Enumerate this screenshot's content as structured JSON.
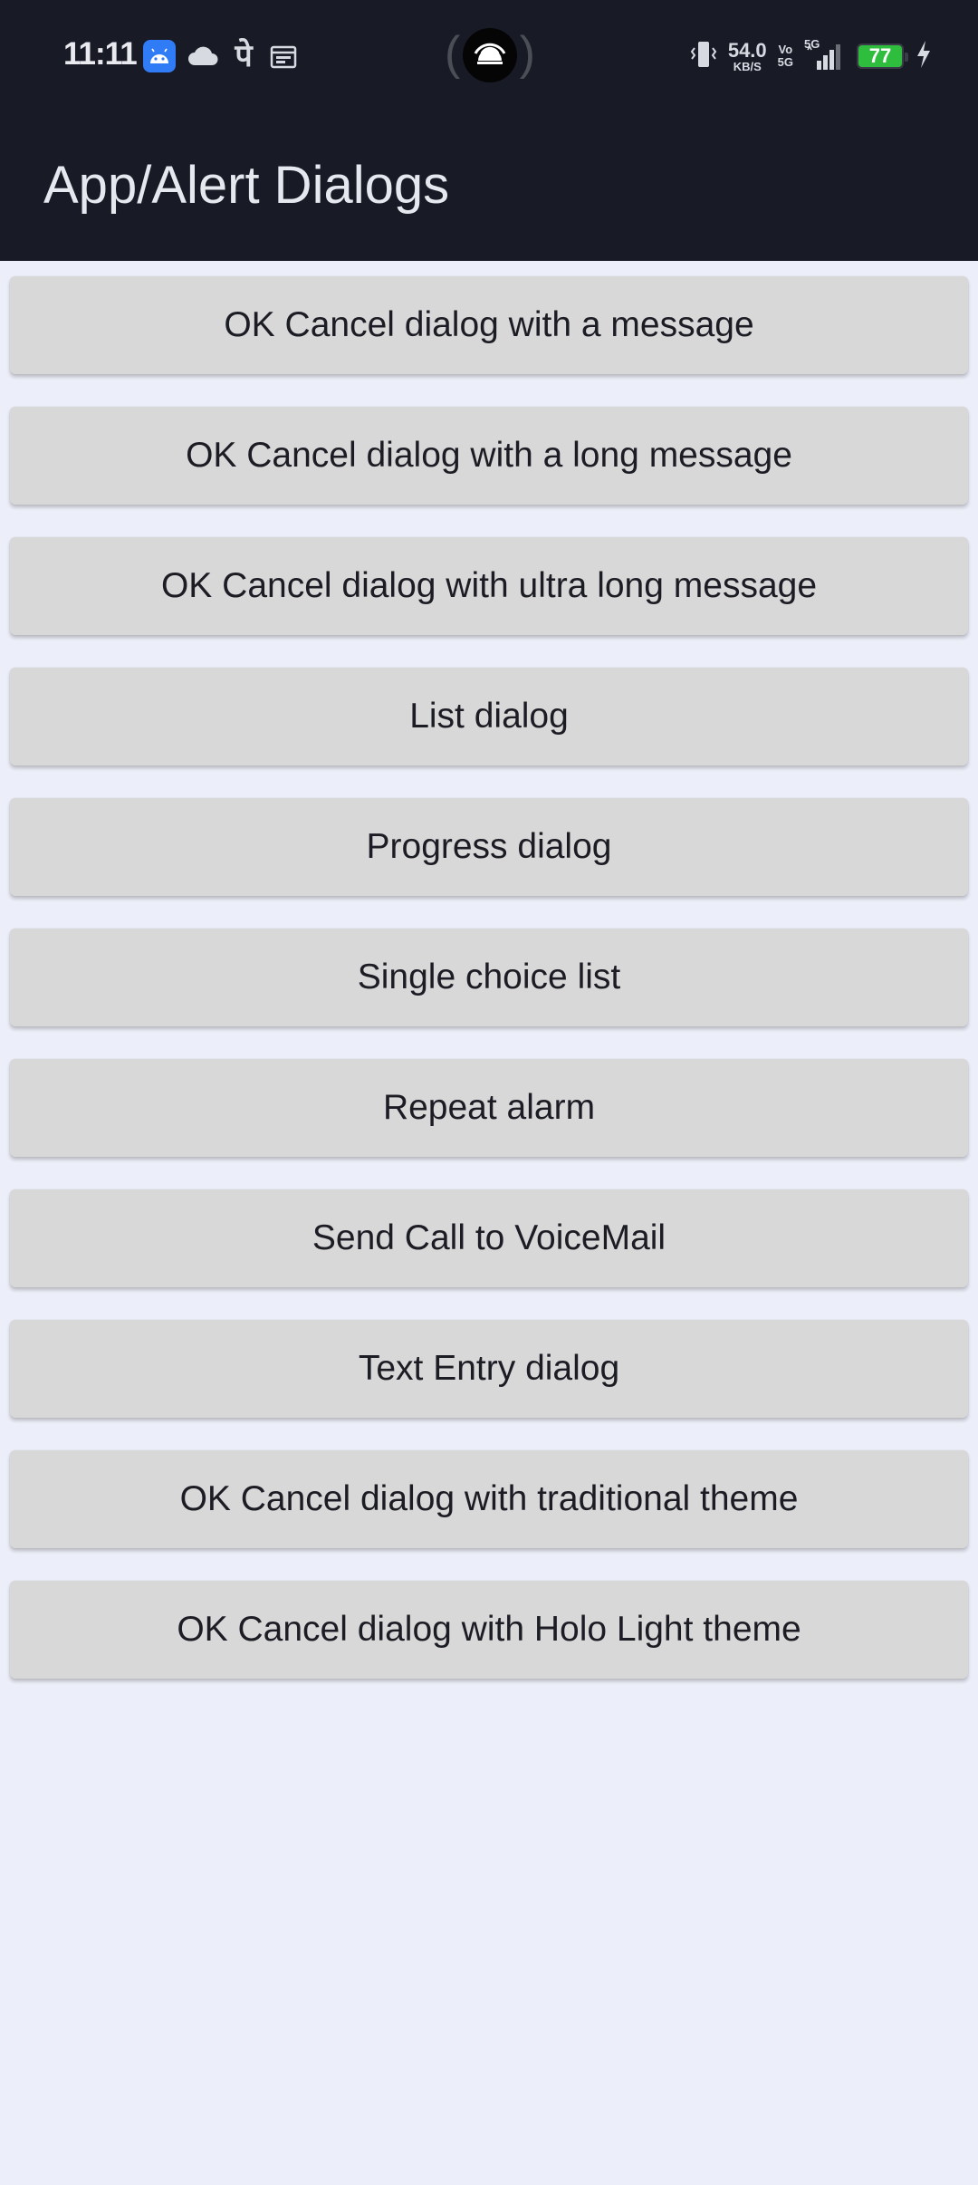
{
  "status_bar": {
    "time": "11:11",
    "network_speed_value": "54.0",
    "network_speed_unit": "KB/S",
    "volte_line1": "Vo",
    "volte_line2": "5G",
    "signal_type": "5G",
    "battery_level": "77",
    "icons": [
      "android-icon",
      "cloud-icon",
      "phonepe-icon",
      "calendar-icon",
      "vibrate-icon",
      "signal-icon",
      "battery-icon",
      "charging-icon"
    ]
  },
  "app_bar": {
    "title": "App/Alert Dialogs"
  },
  "buttons": [
    "OK Cancel dialog with a message",
    "OK Cancel dialog with a long message",
    "OK Cancel dialog with ultra long message",
    "List dialog",
    "Progress dialog",
    "Single choice list",
    "Repeat alarm",
    "Send Call to VoiceMail",
    "Text Entry dialog",
    "OK Cancel dialog with traditional theme",
    "OK Cancel dialog with Holo Light theme"
  ],
  "colors": {
    "app_bar_bg": "#181b26",
    "page_bg": "#eceef9",
    "button_bg": "#d8d8d8",
    "battery_fill": "#2fbd3d"
  }
}
